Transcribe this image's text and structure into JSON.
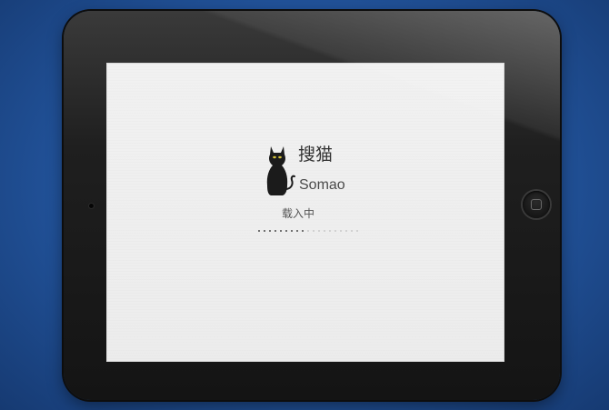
{
  "app": {
    "name_cn": "搜猫",
    "name_en": "Somao"
  },
  "loading": {
    "label": "载入中",
    "progress_dots_total": 19,
    "progress_dots_filled": 9
  },
  "icons": {
    "logo": "black-cat-icon",
    "home_button": "home-button-icon"
  },
  "colors": {
    "background": "#2458a3",
    "bezel": "#1a1a1a",
    "screen": "#eeeeee",
    "cat_eyes": "#d4c23a",
    "text": "#333333"
  }
}
